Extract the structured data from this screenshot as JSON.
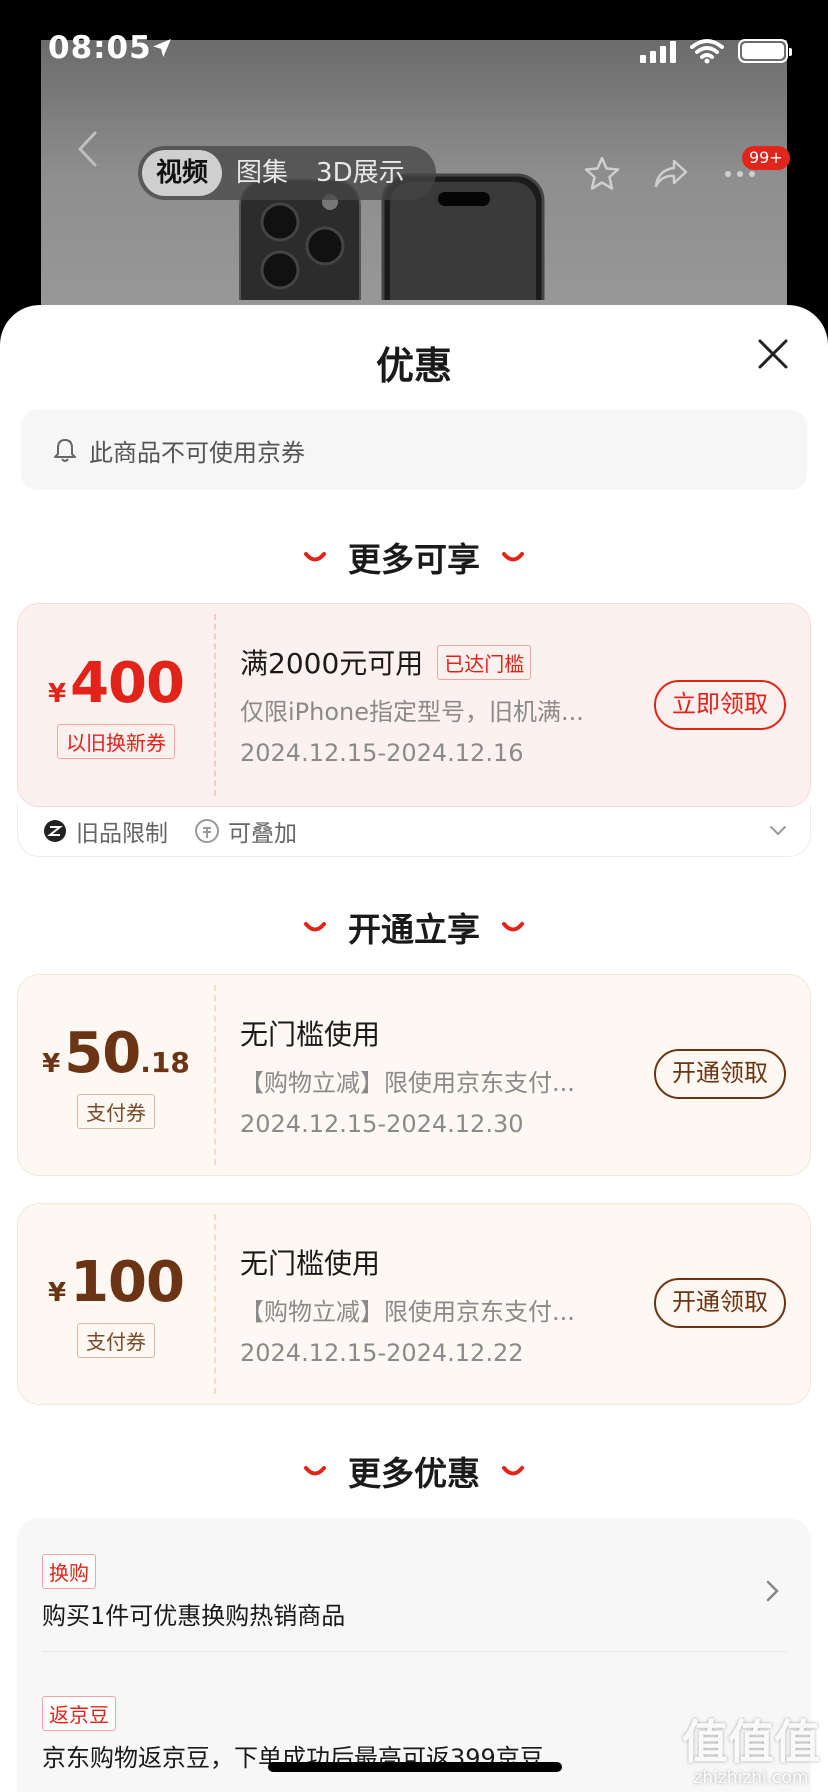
{
  "status": {
    "time": "08:05"
  },
  "product_header": {
    "media_tabs": [
      "视频",
      "图集",
      "3D展示"
    ],
    "active_tab": 0,
    "more_badge": "99+"
  },
  "sheet": {
    "title": "优惠",
    "notice": "此商品不可使用京券"
  },
  "sections": {
    "more_available": "更多可享",
    "open_to_enjoy": "开通立享",
    "more_offers": "更多优惠"
  },
  "coupons": [
    {
      "yen": "¥",
      "amount": "400",
      "decimal": "",
      "tag": "以旧换新券",
      "title": "满2000元可用",
      "status_tag": "已达门槛",
      "desc": "仅限iPhone指定型号，旧机满...",
      "date": "2024.12.15-2024.12.16",
      "button": "立即领取",
      "footer": [
        "旧品限制",
        "可叠加"
      ]
    },
    {
      "yen": "¥",
      "amount": "50",
      "decimal": ".18",
      "tag": "支付券",
      "title": "无门槛使用",
      "desc": "【购物立减】限使用京东支付...",
      "date": "2024.12.15-2024.12.30",
      "button": "开通领取"
    },
    {
      "yen": "¥",
      "amount": "100",
      "decimal": "",
      "tag": "支付券",
      "title": "无门槛使用",
      "desc": "【购物立减】限使用京东支付...",
      "date": "2024.12.15-2024.12.22",
      "button": "开通领取"
    }
  ],
  "more_offers": [
    {
      "tag": "换购",
      "text": "购买1件可优惠换购热销商品"
    },
    {
      "tag": "返京豆",
      "text": "京东购物返京豆，下单成功后最高可返399京豆"
    }
  ],
  "watermark": {
    "big": "值值值",
    "small": "zhizhizhi.com"
  },
  "colors": {
    "accent_red": "#e2231a",
    "brown": "#6b3414"
  }
}
